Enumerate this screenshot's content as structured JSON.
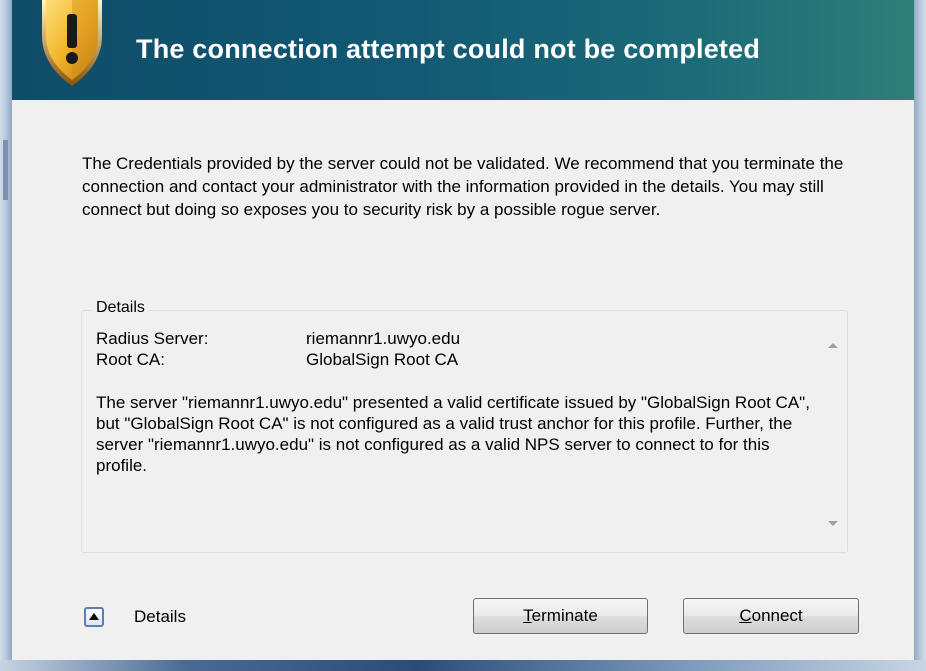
{
  "header": {
    "title": "The connection attempt could not be completed",
    "icon": "warning-shield-icon"
  },
  "message": "The Credentials provided by the server could not be validated. We recommend that you terminate the connection and contact your administrator with the information provided in the details. You may still connect but doing so exposes you to security risk by a possible rogue server.",
  "details": {
    "legend": "Details",
    "rows": [
      {
        "key": "Radius Server:",
        "value": "riemannr1.uwyo.edu"
      },
      {
        "key": "Root CA:",
        "value": "GlobalSign Root CA"
      }
    ],
    "body": "The server \"riemannr1.uwyo.edu\" presented a valid certificate issued by \"GlobalSign Root CA\", but \"GlobalSign Root CA\" is not configured as a valid trust anchor for this profile. Further, the server \"riemannr1.uwyo.edu\" is not configured as a valid NPS server to connect to for this profile."
  },
  "footer": {
    "toggle_label": "Details",
    "terminate_mnemonic": "T",
    "terminate_rest": "erminate",
    "connect_mnemonic": "C",
    "connect_rest": "onnect"
  },
  "colors": {
    "header_start": "#0f4c68",
    "header_end": "#2f7e78",
    "dialog_bg": "#f0f0f0"
  }
}
